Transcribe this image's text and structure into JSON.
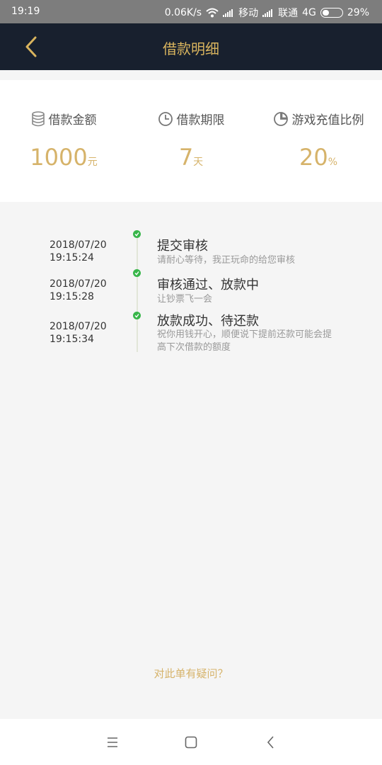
{
  "status_bar": {
    "time": "19:19",
    "speed": "0.06K/s",
    "carrier1": "移动",
    "carrier2": "联通",
    "network": "4G",
    "battery": "29%",
    "battery_level": 0.29
  },
  "header": {
    "title": "借款明细",
    "back_icon": "chevron-left-icon",
    "accent_color": "#d9b45e",
    "bg_color": "#18202e"
  },
  "summary": [
    {
      "icon": "coin-stack-icon",
      "label": "借款金额",
      "value": "1000",
      "unit": "元"
    },
    {
      "icon": "clock-icon",
      "label": "借款期限",
      "value": "7",
      "unit": "天"
    },
    {
      "icon": "pie-chart-icon",
      "label": "游戏充值比例",
      "value": "20",
      "unit": "%"
    }
  ],
  "timeline": [
    {
      "date": "2018/07/20",
      "time": "19:15:24",
      "title": "提交审核",
      "desc": "请耐心等待，我正玩命的给您审核",
      "status_icon": "check-icon"
    },
    {
      "date": "2018/07/20",
      "time": "19:15:28",
      "title": "审核通过、放款中",
      "desc": "让钞票飞一会",
      "status_icon": "check-icon"
    },
    {
      "date": "2018/07/20",
      "time": "19:15:34",
      "title": "放款成功、待还款",
      "desc": "祝你用钱开心，顺便说下提前还款可能会提高下次借款的额度",
      "status_icon": "check-icon"
    }
  ],
  "footer": {
    "question_link": "对此单有疑问？"
  },
  "system_nav": {
    "menu_icon": "menu-icon",
    "home_icon": "home-square-icon",
    "back_icon": "back-arrow-icon"
  }
}
